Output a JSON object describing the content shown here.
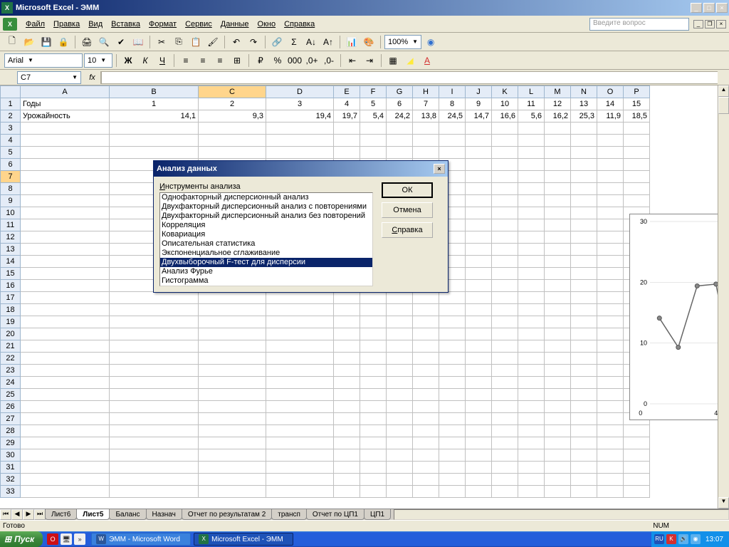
{
  "titlebar": {
    "title": "Microsoft Excel - ЭММ"
  },
  "menu": {
    "file": "Файл",
    "edit": "Правка",
    "view": "Вид",
    "insert": "Вставка",
    "format": "Формат",
    "tools": "Сервис",
    "data": "Данные",
    "window": "Окно",
    "help": "Справка",
    "ask": "Введите вопрос"
  },
  "toolbar": {
    "zoom": "100%",
    "font": "Arial",
    "size": "10"
  },
  "formula": {
    "namebox": "C7",
    "fx": "fx"
  },
  "columns": [
    "A",
    "B",
    "C",
    "D",
    "E",
    "F",
    "G",
    "H",
    "I",
    "J",
    "K",
    "L",
    "M",
    "N",
    "O",
    "P"
  ],
  "rows_count": 33,
  "active_cell": {
    "row": 7,
    "col": "C"
  },
  "cells": {
    "row1": {
      "A": "Годы",
      "B": "1",
      "C": "2",
      "D": "3",
      "E": "4",
      "F": "5",
      "G": "6",
      "H": "7",
      "I": "8",
      "J": "9",
      "K": "10",
      "L": "11",
      "M": "12",
      "N": "13",
      "O": "14",
      "P": "15"
    },
    "row2": {
      "A": "Урожайность",
      "B": "14,1",
      "C": "9,3",
      "D": "19,4",
      "E": "19,7",
      "F": "5,4",
      "G": "24,2",
      "H": "13,8",
      "I": "24,5",
      "J": "14,7",
      "K": "16,6",
      "L": "5,6",
      "M": "16,2",
      "N": "25,3",
      "O": "11,9",
      "P": "18,5"
    }
  },
  "sheets": [
    "Лист6",
    "Лист5",
    "Баланс",
    "Назнач",
    "Отчет по результатам 2",
    "трансп",
    "Отчет по ЦП1",
    "ЦП1"
  ],
  "active_sheet": 1,
  "status": {
    "ready": "Готово",
    "num": "NUM"
  },
  "dialog": {
    "title": "Анализ данных",
    "label": "Инструменты анализа",
    "items": [
      "Однофакторный дисперсионный анализ",
      "Двухфакторный дисперсионный анализ с повторениями",
      "Двухфакторный дисперсионный анализ без повторений",
      "Корреляция",
      "Ковариация",
      "Описательная статистика",
      "Экспоненциальное сглаживание",
      "Двухвыборочный F-тест для дисперсии",
      "Анализ Фурье",
      "Гистограмма"
    ],
    "selected": 7,
    "ok": "ОК",
    "cancel": "Отмена",
    "help": "Справка"
  },
  "taskbar": {
    "start": "Пуск",
    "tasks": [
      {
        "label": "ЭММ - Microsoft Word",
        "active": false
      },
      {
        "label": "Microsoft Excel - ЭММ",
        "active": true
      }
    ],
    "lang": "RU",
    "clock": "13:07"
  },
  "chart_data": {
    "type": "line",
    "x": [
      1,
      2,
      3,
      4
    ],
    "values": [
      14.1,
      9.3,
      19.4,
      19.7
    ],
    "ylim": [
      0,
      30
    ],
    "yticks": [
      0,
      10,
      20,
      30
    ],
    "xticks_shown": [
      0,
      4
    ]
  }
}
